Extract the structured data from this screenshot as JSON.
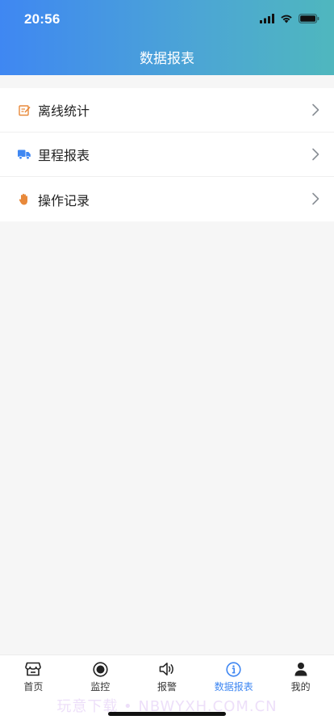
{
  "status_bar": {
    "time": "20:56"
  },
  "header": {
    "title": "数据报表"
  },
  "menu": {
    "items": [
      {
        "label": "离线统计",
        "icon": "checklist-icon",
        "icon_color": "#e8893a"
      },
      {
        "label": "里程报表",
        "icon": "truck-icon",
        "icon_color": "#3f87f2"
      },
      {
        "label": "操作记录",
        "icon": "hand-icon",
        "icon_color": "#e8893a"
      }
    ]
  },
  "tabbar": {
    "active_color": "#3f87f2",
    "tabs": [
      {
        "label": "首页",
        "icon": "store-icon"
      },
      {
        "label": "监控",
        "icon": "record-circle-icon"
      },
      {
        "label": "报警",
        "icon": "speaker-icon"
      },
      {
        "label": "数据报表",
        "icon": "info-circle-icon",
        "active": true
      },
      {
        "label": "我的",
        "icon": "person-icon"
      }
    ]
  },
  "watermark": "玩意下载 • NBWYXH.COM.CN"
}
